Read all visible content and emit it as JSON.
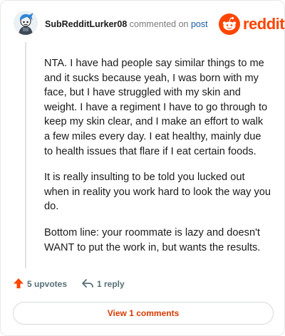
{
  "comment": {
    "author": "SubRedditLurker08",
    "action_text": "commented on",
    "post_link_text": "post",
    "paragraphs": [
      "NTA. I have had people say similar things to me and it sucks because yeah, I was born with my face, but I have struggled with my skin and weight. I have a regiment I have to go through to keep my skin clear, and I make an effort to walk a few miles every day. I eat healthy, mainly due to health issues that flare if I eat certain foods.",
      "It is really insulting to be told you lucked out when in reality you work hard to look the way you do.",
      "Bottom line: your roommate is lazy and doesn't WANT to put the work in, but wants the results."
    ],
    "upvotes_label": "5 upvotes",
    "replies_label": "1 reply",
    "view_comments_label": "View 1 comments"
  },
  "brand": {
    "name": "reddit",
    "icon": "reddit-snoo-icon"
  },
  "icons": {
    "upvote": "upvote-arrow-icon",
    "reply": "reply-arrow-icon"
  },
  "colors": {
    "brand_orange": "#ff4500",
    "upvote_orange": "#ff4500",
    "view_button_text": "#d93a00",
    "link_blue": "#1b5aa8",
    "muted_text": "#576f76"
  }
}
